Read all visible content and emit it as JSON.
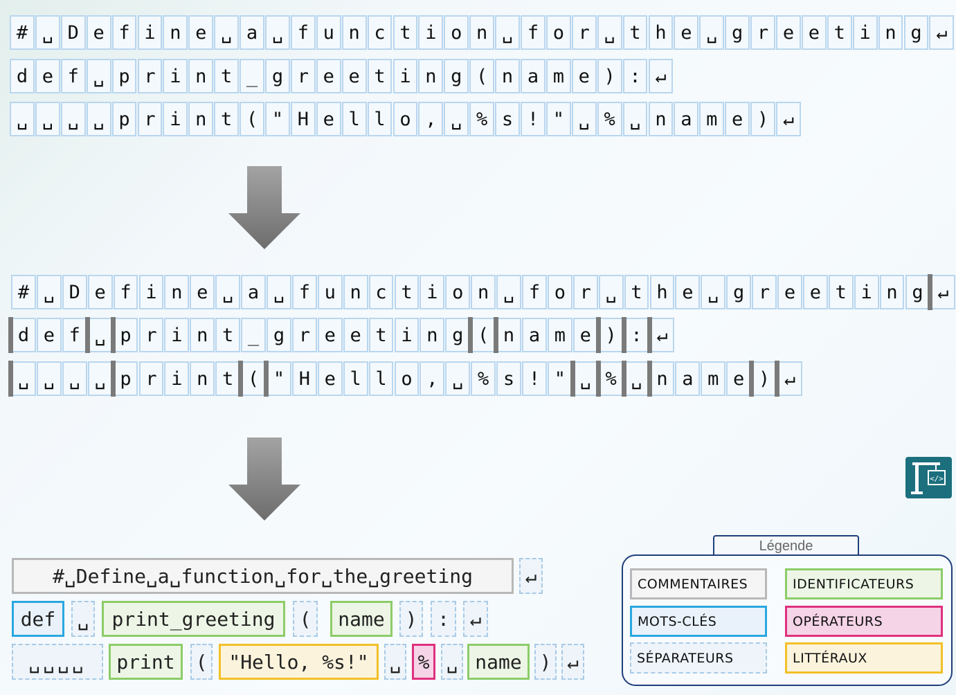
{
  "code_lines": [
    [
      "#",
      "␣",
      "D",
      "e",
      "f",
      "i",
      "n",
      "e",
      "␣",
      "a",
      "␣",
      "f",
      "u",
      "n",
      "c",
      "t",
      "i",
      "o",
      "n",
      "␣",
      "f",
      "o",
      "r",
      "␣",
      "t",
      "h",
      "e",
      "␣",
      "g",
      "r",
      "e",
      "e",
      "t",
      "i",
      "n",
      "g",
      "↵"
    ],
    [
      "d",
      "e",
      "f",
      "␣",
      "p",
      "r",
      "i",
      "n",
      "t",
      "_",
      "g",
      "r",
      "e",
      "e",
      "t",
      "i",
      "n",
      "g",
      "(",
      "n",
      "a",
      "m",
      "e",
      ")",
      ":",
      "↵"
    ],
    [
      "␣",
      "␣",
      "␣",
      "␣",
      "p",
      "r",
      "i",
      "n",
      "t",
      "(",
      "\"",
      "H",
      "e",
      "l",
      "l",
      "o",
      ",",
      "␣",
      "%",
      "s",
      "!",
      "\"",
      "␣",
      "%",
      "␣",
      "n",
      "a",
      "m",
      "e",
      ")",
      "↵"
    ]
  ],
  "token_rows": [
    [
      {
        "text": "#␣Define␣a␣function␣for␣the␣greeting",
        "kind": "comment"
      },
      {
        "text": "↵",
        "kind": "separator"
      }
    ],
    [
      {
        "text": "def",
        "kind": "keyword"
      },
      {
        "text": "␣",
        "kind": "separator"
      },
      {
        "text": "print_greeting",
        "kind": "identifier"
      },
      {
        "text": "(",
        "kind": "separator"
      },
      {
        "text": "name",
        "kind": "identifier"
      },
      {
        "text": ")",
        "kind": "separator"
      },
      {
        "text": ":",
        "kind": "separator"
      },
      {
        "text": "↵",
        "kind": "separator"
      }
    ],
    [
      {
        "text": "␣␣␣␣",
        "kind": "separator"
      },
      {
        "text": "print",
        "kind": "identifier"
      },
      {
        "text": "(",
        "kind": "separator"
      },
      {
        "text": "\"Hello, %s!\"",
        "kind": "literal"
      },
      {
        "text": "␣",
        "kind": "separator"
      },
      {
        "text": "%",
        "kind": "operator"
      },
      {
        "text": "␣",
        "kind": "separator"
      },
      {
        "text": "name",
        "kind": "identifier"
      },
      {
        "text": ")",
        "kind": "separator"
      },
      {
        "text": "↵",
        "kind": "separator"
      }
    ]
  ],
  "legend": {
    "title": "Légende",
    "items": [
      {
        "label": "COMMENTAIRES",
        "kind": "comment"
      },
      {
        "label": "IDENTIFICATEURS",
        "kind": "identifier"
      },
      {
        "label": "MOTS-CLÉS",
        "kind": "keyword"
      },
      {
        "label": "OPÉRATEURS",
        "kind": "operator"
      },
      {
        "label": "SÉPARATEURS",
        "kind": "separator"
      },
      {
        "label": "LITTÉRAUX",
        "kind": "literal"
      }
    ]
  },
  "colors": {
    "comment": "#b8b8b8",
    "keyword": "#29a8e0",
    "identifier": "#8ccc68",
    "operator": "#e0307e",
    "literal": "#f2c027",
    "separator": "#a8cae6",
    "boundary_bar": "#7a7a7a",
    "legend_border": "#1f3f7a"
  },
  "logo_icon": "crane-code-icon"
}
